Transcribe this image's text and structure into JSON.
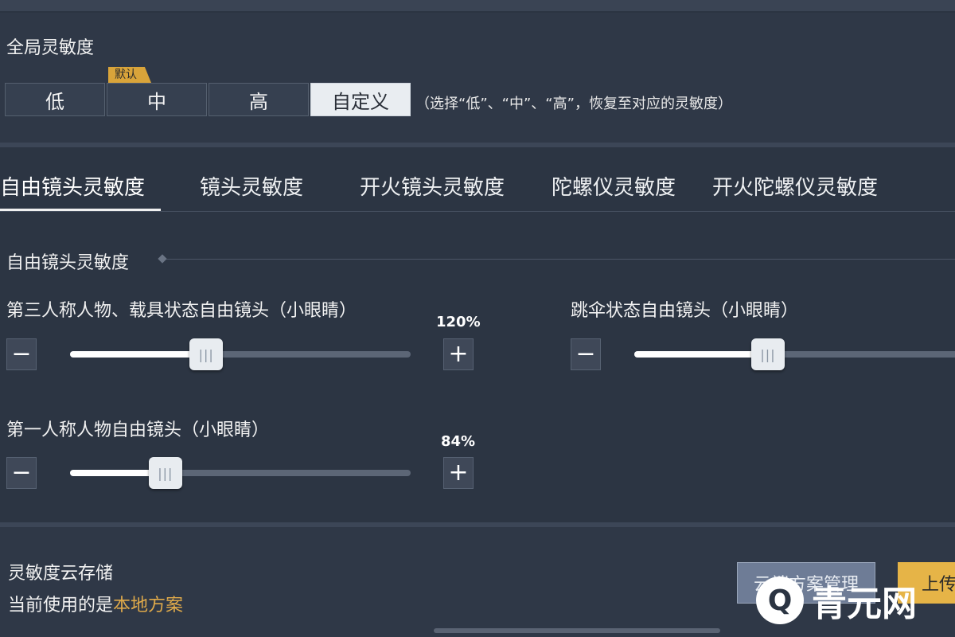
{
  "global": {
    "title": "全局灵敏度",
    "default_tag": "默认",
    "presets": [
      {
        "label": "低",
        "active": false
      },
      {
        "label": "中",
        "active": false
      },
      {
        "label": "高",
        "active": false
      },
      {
        "label": "自定义",
        "active": true
      }
    ],
    "hint": "（选择“低”、“中”、“高”，恢复至对应的灵敏度）"
  },
  "tabs": [
    {
      "label": "自由镜头灵敏度",
      "active": true
    },
    {
      "label": "镜头灵敏度",
      "active": false
    },
    {
      "label": "开火镜头灵敏度",
      "active": false
    },
    {
      "label": "陀螺仪灵敏度",
      "active": false
    },
    {
      "label": "开火陀螺仪灵敏度",
      "active": false
    }
  ],
  "section": {
    "title": "自由镜头灵敏度"
  },
  "sliders": [
    {
      "label": "第三人称人物、载具状态自由镜头（小眼睛）",
      "value_text": "120%",
      "fraction": 0.4
    },
    {
      "label": "跳伞状态自由镜头（小眼睛）",
      "value_text": "",
      "fraction": 0.4
    },
    {
      "label": "第一人称人物自由镜头（小眼睛）",
      "value_text": "84%",
      "fraction": 0.28
    }
  ],
  "controls": {
    "minus": "−",
    "plus": "+",
    "thumb_grip": "|||"
  },
  "cloud": {
    "title": "灵敏度云存储",
    "current_prefix": "当前使用的是",
    "current_value": "本地方案",
    "manage_label": "云端方案管理",
    "upload_label": "上传"
  },
  "watermark": {
    "logo_glyph": "Q",
    "text": "青元网"
  },
  "colors": {
    "accent_gold": "#e0aa4a",
    "tag_gold": "#d9a43a",
    "bg": "#2b3442"
  }
}
